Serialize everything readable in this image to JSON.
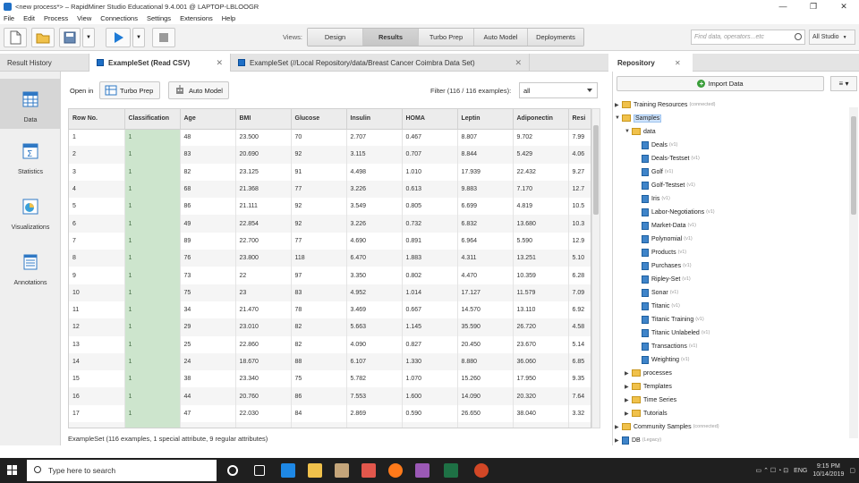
{
  "window": {
    "title": "<new process*> – RapidMiner Studio Educational 9.4.001 @ LAPTOP-LBLOOGR"
  },
  "menu": [
    "File",
    "Edit",
    "Process",
    "View",
    "Connections",
    "Settings",
    "Extensions",
    "Help"
  ],
  "views": {
    "label": "Views:",
    "items": [
      "Design",
      "Results",
      "Turbo Prep",
      "Auto Model",
      "Deployments"
    ],
    "active": "Results"
  },
  "search": {
    "placeholder": "Find data, operators...etc",
    "studio": "All Studio"
  },
  "tabs": [
    {
      "label": "Result History"
    },
    {
      "label": "ExampleSet (Read CSV)"
    },
    {
      "label": "ExampleSet (//Local Repository/data/Breast Cancer Coimbra Data Set)"
    }
  ],
  "leftnav": [
    "Data",
    "Statistics",
    "Visualizations",
    "Annotations"
  ],
  "content": {
    "open_in": "Open in",
    "turbo_prep": "Turbo Prep",
    "auto_model": "Auto Model",
    "filter_label": "Filter (116 / 116 examples):",
    "filter_value": "all",
    "status": "ExampleSet (116 examples, 1 special attribute, 9 regular attributes)"
  },
  "table": {
    "columns": [
      "Row No.",
      "Classification",
      "Age",
      "BMI",
      "Glucose",
      "Insulin",
      "HOMA",
      "Leptin",
      "Adiponectin",
      "Resi"
    ],
    "rows": [
      [
        "1",
        "1",
        "48",
        "23.500",
        "70",
        "2.707",
        "0.467",
        "8.807",
        "9.702",
        "7.99"
      ],
      [
        "2",
        "1",
        "83",
        "20.690",
        "92",
        "3.115",
        "0.707",
        "8.844",
        "5.429",
        "4.06"
      ],
      [
        "3",
        "1",
        "82",
        "23.125",
        "91",
        "4.498",
        "1.010",
        "17.939",
        "22.432",
        "9.27"
      ],
      [
        "4",
        "1",
        "68",
        "21.368",
        "77",
        "3.226",
        "0.613",
        "9.883",
        "7.170",
        "12.7"
      ],
      [
        "5",
        "1",
        "86",
        "21.111",
        "92",
        "3.549",
        "0.805",
        "6.699",
        "4.819",
        "10.5"
      ],
      [
        "6",
        "1",
        "49",
        "22.854",
        "92",
        "3.226",
        "0.732",
        "6.832",
        "13.680",
        "10.3"
      ],
      [
        "7",
        "1",
        "89",
        "22.700",
        "77",
        "4.690",
        "0.891",
        "6.964",
        "5.590",
        "12.9"
      ],
      [
        "8",
        "1",
        "76",
        "23.800",
        "118",
        "6.470",
        "1.883",
        "4.311",
        "13.251",
        "5.10"
      ],
      [
        "9",
        "1",
        "73",
        "22",
        "97",
        "3.350",
        "0.802",
        "4.470",
        "10.359",
        "6.28"
      ],
      [
        "10",
        "1",
        "75",
        "23",
        "83",
        "4.952",
        "1.014",
        "17.127",
        "11.579",
        "7.09"
      ],
      [
        "11",
        "1",
        "34",
        "21.470",
        "78",
        "3.469",
        "0.667",
        "14.570",
        "13.110",
        "6.92"
      ],
      [
        "12",
        "1",
        "29",
        "23.010",
        "82",
        "5.663",
        "1.145",
        "35.590",
        "26.720",
        "4.58"
      ],
      [
        "13",
        "1",
        "25",
        "22.860",
        "82",
        "4.090",
        "0.827",
        "20.450",
        "23.670",
        "5.14"
      ],
      [
        "14",
        "1",
        "24",
        "18.670",
        "88",
        "6.107",
        "1.330",
        "8.880",
        "36.060",
        "6.85"
      ],
      [
        "15",
        "1",
        "38",
        "23.340",
        "75",
        "5.782",
        "1.070",
        "15.260",
        "17.950",
        "9.35"
      ],
      [
        "16",
        "1",
        "44",
        "20.760",
        "86",
        "7.553",
        "1.600",
        "14.090",
        "20.320",
        "7.64"
      ],
      [
        "17",
        "1",
        "47",
        "22.030",
        "84",
        "2.869",
        "0.590",
        "26.650",
        "38.040",
        "3.32"
      ],
      [
        "18",
        "1",
        "61",
        "32.039",
        "85",
        "18.077",
        "3.790",
        "30.773",
        "7.780",
        "13.6"
      ]
    ]
  },
  "repository": {
    "title": "Repository",
    "import": "Import Data",
    "tree": [
      {
        "label": "Training Resources",
        "suffix": "(connected)",
        "level": 0,
        "type": "folder",
        "toggle": "▶"
      },
      {
        "label": "Samples",
        "suffix": "",
        "level": 0,
        "type": "folder",
        "toggle": "▼",
        "selected": true
      },
      {
        "label": "data",
        "suffix": "",
        "level": 1,
        "type": "folder",
        "toggle": "▼"
      },
      {
        "label": "Deals",
        "suffix": "(v1)",
        "level": 2,
        "type": "db"
      },
      {
        "label": "Deals-Testset",
        "suffix": "(v1)",
        "level": 2,
        "type": "db"
      },
      {
        "label": "Golf",
        "suffix": "(v1)",
        "level": 2,
        "type": "db"
      },
      {
        "label": "Golf-Testset",
        "suffix": "(v1)",
        "level": 2,
        "type": "db"
      },
      {
        "label": "Iris",
        "suffix": "(v1)",
        "level": 2,
        "type": "db"
      },
      {
        "label": "Labor-Negotiations",
        "suffix": "(v1)",
        "level": 2,
        "type": "db"
      },
      {
        "label": "Market-Data",
        "suffix": "(v1)",
        "level": 2,
        "type": "db"
      },
      {
        "label": "Polynomial",
        "suffix": "(v1)",
        "level": 2,
        "type": "db"
      },
      {
        "label": "Products",
        "suffix": "(v1)",
        "level": 2,
        "type": "db"
      },
      {
        "label": "Purchases",
        "suffix": "(v1)",
        "level": 2,
        "type": "db"
      },
      {
        "label": "Ripley-Set",
        "suffix": "(v1)",
        "level": 2,
        "type": "db"
      },
      {
        "label": "Sonar",
        "suffix": "(v1)",
        "level": 2,
        "type": "db"
      },
      {
        "label": "Titanic",
        "suffix": "(v1)",
        "level": 2,
        "type": "db"
      },
      {
        "label": "Titanic Training",
        "suffix": "(v1)",
        "level": 2,
        "type": "db"
      },
      {
        "label": "Titanic Unlabeled",
        "suffix": "(v1)",
        "level": 2,
        "type": "db"
      },
      {
        "label": "Transactions",
        "suffix": "(v1)",
        "level": 2,
        "type": "db"
      },
      {
        "label": "Weighting",
        "suffix": "(v1)",
        "level": 2,
        "type": "db"
      },
      {
        "label": "processes",
        "suffix": "",
        "level": 1,
        "type": "folder",
        "toggle": "▶"
      },
      {
        "label": "Templates",
        "suffix": "",
        "level": 1,
        "type": "folder",
        "toggle": "▶"
      },
      {
        "label": "Time Series",
        "suffix": "",
        "level": 1,
        "type": "folder",
        "toggle": "▶"
      },
      {
        "label": "Tutorials",
        "suffix": "",
        "level": 1,
        "type": "folder",
        "toggle": "▶"
      },
      {
        "label": "Community Samples",
        "suffix": "(connected)",
        "level": 0,
        "type": "folder",
        "toggle": "▶"
      },
      {
        "label": "DB",
        "suffix": "(Legacy)",
        "level": 0,
        "type": "db",
        "toggle": "▶"
      }
    ]
  },
  "taskbar": {
    "search": "Type here to search",
    "lang": "ENG",
    "time": "9:15 PM",
    "date": "10/14/2019"
  }
}
